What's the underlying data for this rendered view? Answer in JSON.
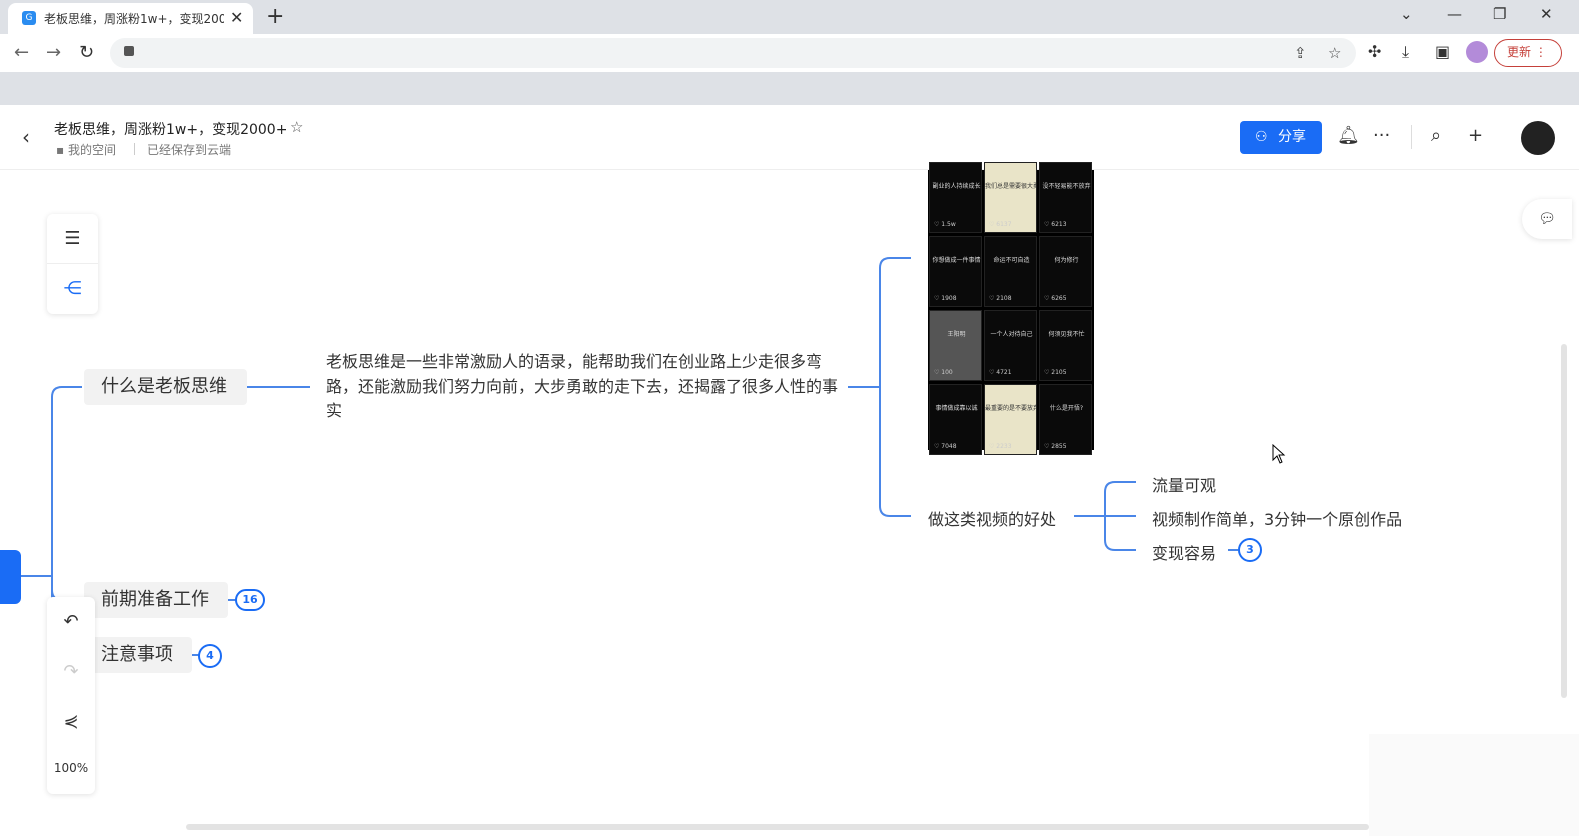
{
  "browser": {
    "tab_title": "老板思维，周涨粉1w+，变现2000+",
    "update_label": "更新",
    "favicon_letter": "G"
  },
  "header": {
    "title": "老板思维，周涨粉1w+，变现2000+",
    "breadcrumb": "我的空间",
    "save_status": "已经保存到云端",
    "share_label": "分享"
  },
  "mindmap": {
    "branch1": "什么是老板思维",
    "branch1_desc": "老板思维是一些非常激励人的语录，能帮助我们在创业路上少走很多弯路，还能激励我们努力向前，大步勇敢的走下去，还揭露了很多人性的事实",
    "benefits_title": "做这类视频的好处",
    "benefits": [
      "流量可观",
      "视频制作简单，3分钟一个原创作品",
      "变现容易"
    ],
    "benefits_badge": "3",
    "branch2": "前期准备工作",
    "branch2_badge": "16",
    "branch3": "注意事项",
    "branch3_badge": "4"
  },
  "image_grid": {
    "cells": [
      {
        "text": "副业的人持续成长",
        "count": "1.5w",
        "style": "dark"
      },
      {
        "text": "我们总是需要很大勇气",
        "count": "6137",
        "style": "light"
      },
      {
        "text": "没不轻易能不放弃",
        "count": "6213",
        "style": "dark"
      },
      {
        "text": "你想做成一件事情",
        "count": "1908",
        "style": "dark"
      },
      {
        "text": "命运不可自造",
        "count": "2108",
        "style": "dark"
      },
      {
        "text": "何为修行",
        "count": "6265",
        "style": "dark"
      },
      {
        "text": "王阳明",
        "count": "100",
        "style": "gray"
      },
      {
        "text": "一个人对待自己",
        "count": "4721",
        "style": "dark"
      },
      {
        "text": "何须见我不忙",
        "count": "2105",
        "style": "dark"
      },
      {
        "text": "事情做成靠以诚",
        "count": "7048",
        "style": "dark"
      },
      {
        "text": "最重要的是不要放弃",
        "count": "2233",
        "style": "light"
      },
      {
        "text": "什么是开悟?",
        "count": "2855",
        "style": "dark"
      }
    ]
  },
  "zoom_level": "100%",
  "colors": {
    "accent": "#1a6cf5",
    "update": "#c5403a"
  }
}
